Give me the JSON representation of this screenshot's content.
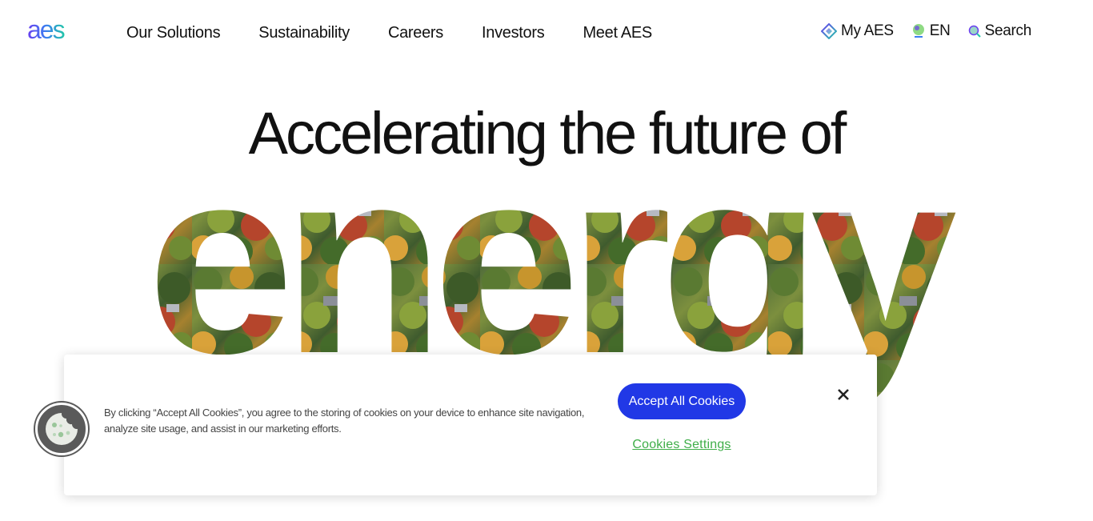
{
  "header": {
    "logo_text": "aes",
    "nav": [
      {
        "label": "Our Solutions"
      },
      {
        "label": "Sustainability"
      },
      {
        "label": "Careers"
      },
      {
        "label": "Investors"
      },
      {
        "label": "Meet AES"
      }
    ],
    "utility": {
      "my_aes": "My AES",
      "language": "EN",
      "search": "Search"
    }
  },
  "hero": {
    "headline": "Accelerating the future of",
    "big_word": "energy"
  },
  "cookie_banner": {
    "text": "By clicking “Accept All Cookies”, you agree to the storing of cookies on your device to enhance site navigation, analyze site usage, and assist in our marketing efforts.",
    "accept_label": "Accept All Cookies",
    "settings_label": "Cookies Settings"
  },
  "colors": {
    "accent_blue": "#2138e6",
    "accent_green": "#3fae49",
    "logo_purple": "#6a3ef0",
    "logo_teal": "#22c7a9"
  }
}
